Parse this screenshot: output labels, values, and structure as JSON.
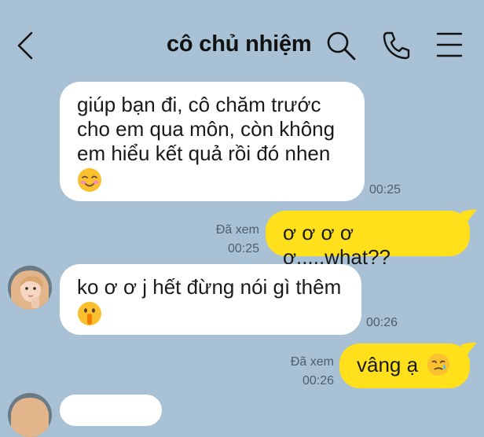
{
  "header": {
    "title": "cô chủ nhiệm"
  },
  "messages": [
    {
      "sender": "other",
      "lines": [
        "giúp bạn đi, cô chăm trước",
        "cho em qua môn, còn không",
        "em hiểu kết quả rồi đó nhen"
      ],
      "emoji": "smiling-blush-emoji",
      "time": "00:25"
    },
    {
      "sender": "me",
      "text": "ơ ơ ơ ơ ơ.....what??",
      "seen": "Đã xem",
      "time": "00:25"
    },
    {
      "sender": "other",
      "text": "ko ơ ơ j hết đừng nói gì thêm",
      "emoji": "shushing-face-emoji",
      "time": "00:26"
    },
    {
      "sender": "me",
      "text": "vâng ạ",
      "emoji": "tearful-smile-emoji",
      "seen": "Đã xem",
      "time": "00:26"
    }
  ],
  "colors": {
    "background": "#a9c1d4",
    "incoming_bubble": "#ffffff",
    "outgoing_bubble": "#ffe01b"
  }
}
